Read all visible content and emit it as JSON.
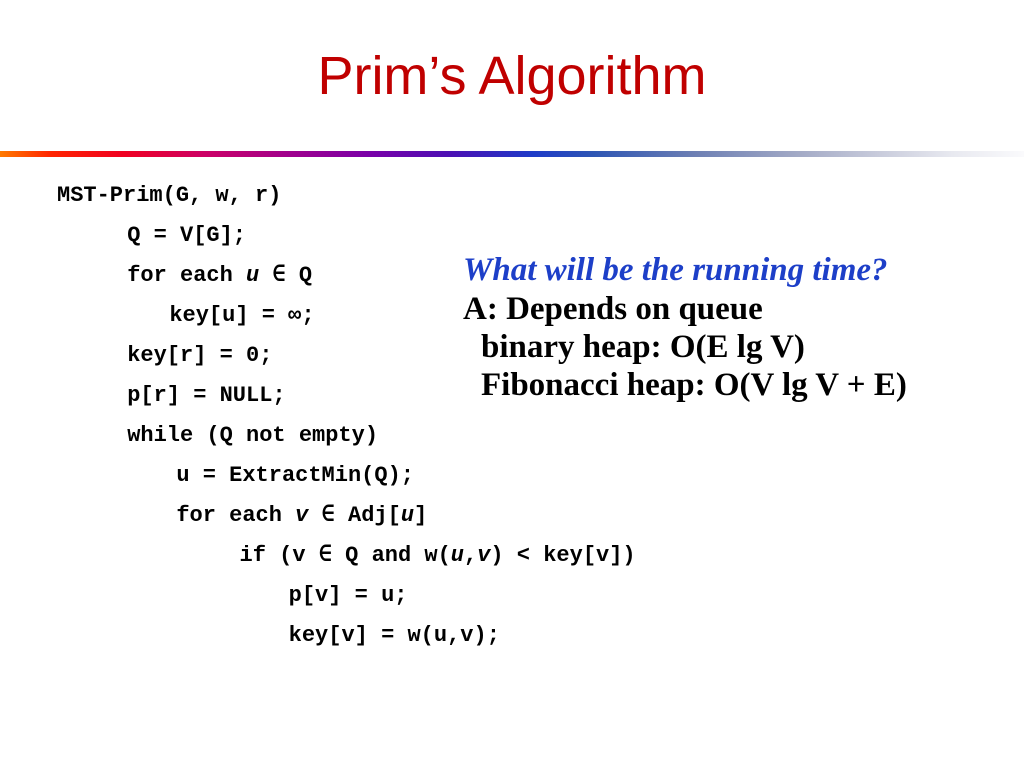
{
  "slide": {
    "title": "Prim’s Algorithm",
    "title_color": "#C00000",
    "background_color": "#FFFFFF",
    "rule": {
      "name": "gradient-divider",
      "start_color": "#FF7A00",
      "mid_color": "#7A00A8",
      "accent_color": "#1E3BC8",
      "end_color": "#FAFAFC"
    }
  },
  "code": {
    "language": "pseudocode",
    "lines": [
      {
        "indent": 0,
        "html": "MST-Prim(G, w, r)"
      },
      {
        "indent": 1,
        "html": "Q = V[G];"
      },
      {
        "indent": 1,
        "html": "for each <i>u</i> ∈ Q"
      },
      {
        "indent": 1.6,
        "html": "key[u] = ∞;"
      },
      {
        "indent": 1,
        "html": "key[r] = 0;"
      },
      {
        "indent": 1,
        "html": "p[r] = NULL;"
      },
      {
        "indent": 1,
        "html": "while (Q not empty)"
      },
      {
        "indent": 1.7,
        "html": "u = ExtractMin(Q);"
      },
      {
        "indent": 1.7,
        "html": "for each <i>v</i> ∈ Adj[<i>u</i>]"
      },
      {
        "indent": 2.6,
        "html": "if (v ∈ Q and w(<i>u</i>,<i>v</i>) &lt; key[v])"
      },
      {
        "indent": 3.3,
        "html": "p[v] = u;"
      },
      {
        "indent": 3.3,
        "html": "key[v] = w(u,v);"
      }
    ],
    "plain": [
      "MST-Prim(G, w, r)",
      "    Q = V[G];",
      "    for each u ∈ Q",
      "        key[u] = ∞;",
      "    key[r] = 0;",
      "    p[r] = NULL;",
      "    while (Q not empty)",
      "        u = ExtractMin(Q);",
      "        for each v ∈ Adj[u]",
      "            if (v ∈ Q and w(u,v) < key[v])",
      "                p[v] = u;",
      "                key[v] = w(u,v);"
    ]
  },
  "annotation": {
    "question": "What will be the running time?",
    "question_color": "#1D3FC8",
    "answer_color": "#000000",
    "answers": [
      {
        "text": "A: Depends on queue",
        "indented": false
      },
      {
        "text": "binary heap: O(E lg V)",
        "indented": true
      },
      {
        "text": "Fibonacci heap: O(V lg V + E)",
        "indented": true
      }
    ]
  }
}
